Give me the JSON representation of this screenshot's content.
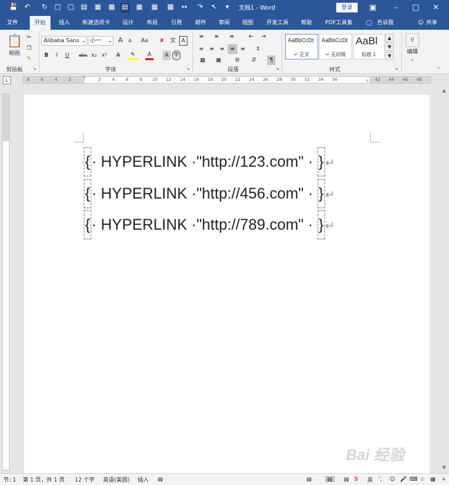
{
  "window": {
    "title": "文档1 - Word",
    "login_label": "登录",
    "minimize_icon": "minimize-icon",
    "restore_icon": "restore-icon",
    "close_icon": "close-icon"
  },
  "quick_access": [
    "save-icon",
    "undo-icon",
    "redo-icon",
    "print-preview-icon",
    "new-doc-icon",
    "open-icon",
    "paste-special-icon",
    "screenshot-icon",
    "view-icon",
    "draw-table-icon",
    "format-painter-icon",
    "select-icon",
    "customize-icon"
  ],
  "tabs": [
    {
      "label": "文件",
      "active": false
    },
    {
      "label": "开始",
      "active": true
    },
    {
      "label": "插入",
      "active": false
    },
    {
      "label": "新建选项卡",
      "active": false
    },
    {
      "label": "设计",
      "active": false
    },
    {
      "label": "布局",
      "active": false
    },
    {
      "label": "引用",
      "active": false
    },
    {
      "label": "邮件",
      "active": false
    },
    {
      "label": "审阅",
      "active": false
    },
    {
      "label": "视图",
      "active": false
    },
    {
      "label": "开发工具",
      "active": false
    },
    {
      "label": "帮助",
      "active": false
    },
    {
      "label": "PDF工具集",
      "active": false
    },
    {
      "label": "告诉我",
      "active": false
    },
    {
      "label": "共享",
      "active": false
    }
  ],
  "ribbon": {
    "paste_label": "粘贴",
    "clipboard_label": "剪贴板",
    "font_name": "Alibaba Sans",
    "font_size": "小一",
    "font_group_label": "字体",
    "para_group_label": "段落",
    "styles_group_label": "样式",
    "edit_label": "编辑",
    "bold": "B",
    "italic": "I",
    "underline": "U",
    "strike": "abc",
    "subscript": "x₂",
    "superscript": "x²",
    "grow_font": "A",
    "shrink_font": "A",
    "change_case": "Aa",
    "text_effect": "A",
    "font_color": "A",
    "char_shading": "A",
    "styles": [
      {
        "sample": "AaBbCcDt",
        "name": "↵ 正文",
        "selected": true
      },
      {
        "sample": "AaBbCcDt",
        "name": "↵ 无间隔",
        "selected": false
      },
      {
        "sample": "AaBl",
        "name": "标题 1",
        "selected": false
      }
    ]
  },
  "ruler": {
    "ticks": [
      "8",
      "6",
      "4",
      "2",
      "",
      "2",
      "4",
      "6",
      "8",
      "10",
      "12",
      "14",
      "16",
      "18",
      "20",
      "22",
      "24",
      "26",
      "28",
      "30",
      "32",
      "34",
      "36",
      "",
      "42",
      "44",
      "46",
      "48"
    ]
  },
  "document": {
    "lines": [
      "{ HYPERLINK \"http://123.com\" }",
      "{ HYPERLINK \"http://456.com\" }",
      "{ HYPERLINK \"http://789.com\" }"
    ],
    "field_lines": [
      {
        "code": "· HYPERLINK ·\"http://123.com\" · "
      },
      {
        "code": "· HYPERLINK ·\"http://456.com\" · "
      },
      {
        "code": "· HYPERLINK ·\"http://789.com\" · "
      }
    ],
    "brace_open": "{",
    "brace_close": "}",
    "para_mark": "↵"
  },
  "status": {
    "section": "节: 1",
    "page": "第 1 页，共 1 页",
    "words": "12 个字",
    "language": "英语(美国)",
    "mode": "插入",
    "ime": "英"
  },
  "watermark": "Bai 经验"
}
